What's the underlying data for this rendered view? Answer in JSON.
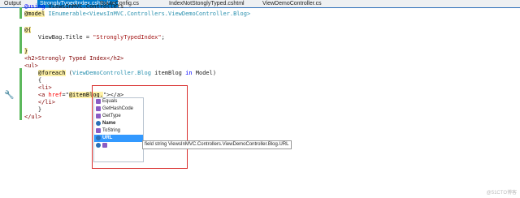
{
  "tabs": [
    {
      "label": "Output"
    },
    {
      "label": "StronglyTypedIndex.cshtml*",
      "close": "×"
    },
    {
      "label": "RouteConfig.cs"
    },
    {
      "label": "IndexNotStonglyTyped.cshtml"
    },
    {
      "label": "ViewDemoController.cs"
    }
  ],
  "code": {
    "l0_kw": "@using",
    "l0_rest": " ViewsInMVC.Controllers",
    "l1_kw": "@model",
    "l1_type": " IEnumerable<ViewsInMVC.Controllers.ViewDemoController.Blog>",
    "l3": "@{",
    "l4_a": "    ViewBag.Title = ",
    "l4_str": "\"StronglyTypedIndex\"",
    "l4_b": ";",
    "l6": "}",
    "l7": "<h2>Strongly Typed Index</h2>",
    "l8": "<ul>",
    "l9_razor": "@foreach",
    "l9_a": " (",
    "l9_type": "ViewDemoController.Blog",
    "l9_b": " itemBlog ",
    "l9_in": "in",
    "l9_c": " Model)",
    "l10": "    {",
    "l11": "    <li>",
    "l12_a": "    <a ",
    "l12_attr": "href",
    "l12_b": "=\"",
    "l12_razor": "@itemBlog.",
    "l12_c": "\"></a>",
    "l13": "    </li>",
    "l14": "    }",
    "l15": "</ul>"
  },
  "intellisense": {
    "items": [
      {
        "label": "Equals",
        "kind": "method"
      },
      {
        "label": "GetHashCode",
        "kind": "method"
      },
      {
        "label": "GetType",
        "kind": "method"
      },
      {
        "label": "Name",
        "kind": "field"
      },
      {
        "label": "ToString",
        "kind": "method"
      },
      {
        "label": "URL",
        "kind": "field"
      }
    ],
    "tooltip": "field string ViewsInMVC.Controllers.ViewDemoController.Blog.URL"
  },
  "watermark": "@51CTO博客"
}
